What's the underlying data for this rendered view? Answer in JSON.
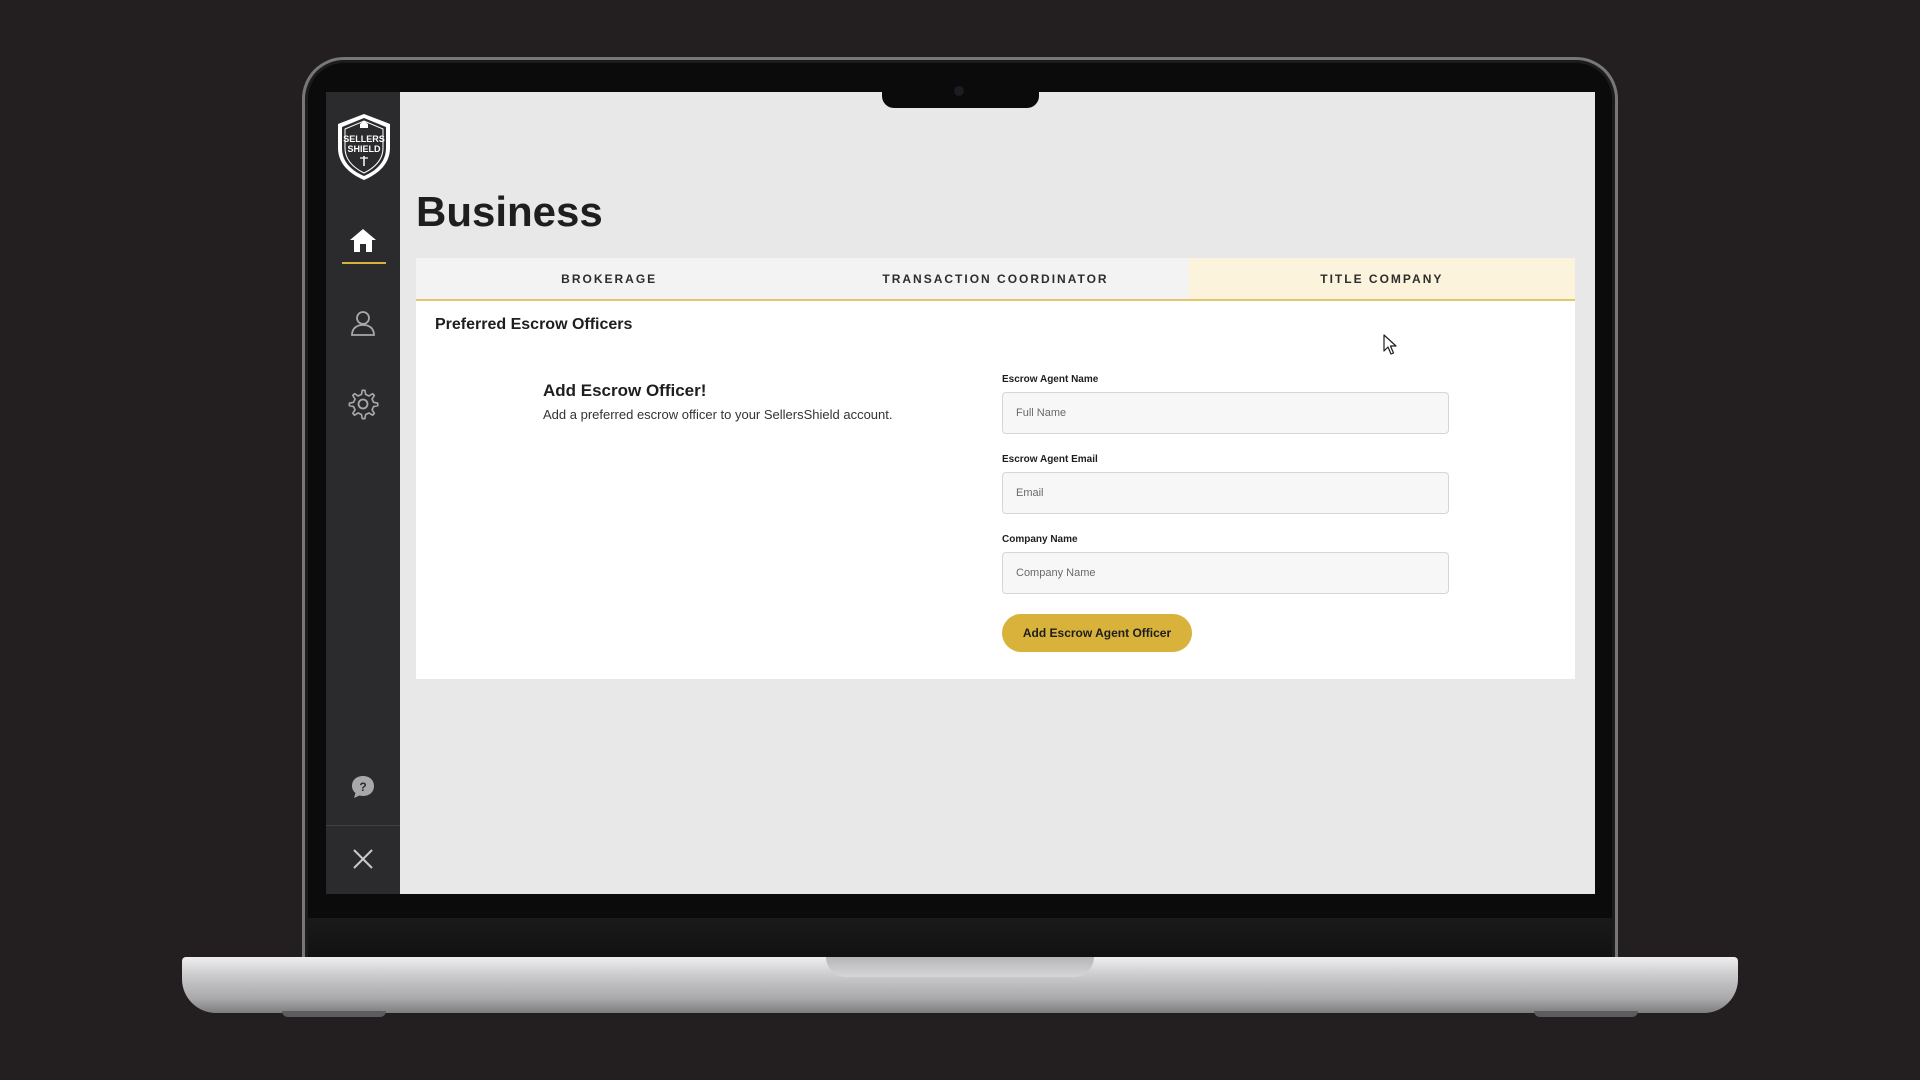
{
  "app": {
    "page_title": "Business",
    "logo_text": "SELLERS SHIELD"
  },
  "sidebar": {
    "items": [
      {
        "name": "home",
        "icon": "home-icon",
        "active": true
      },
      {
        "name": "profile",
        "icon": "user-icon",
        "active": false
      },
      {
        "name": "settings",
        "icon": "gear-icon",
        "active": false
      },
      {
        "name": "help",
        "icon": "help-chat-icon",
        "active": false
      },
      {
        "name": "close",
        "icon": "close-icon",
        "active": false
      }
    ]
  },
  "tabs": [
    {
      "label": "BROKERAGE",
      "active": false
    },
    {
      "label": "TRANSACTION COORDINATOR",
      "active": false
    },
    {
      "label": "TITLE COMPANY",
      "active": true
    }
  ],
  "section": {
    "title": "Preferred Escrow Officers",
    "intro_title": "Add Escrow Officer!",
    "intro_text": "Add a preferred escrow officer to your SellersShield account."
  },
  "form": {
    "name_label": "Escrow Agent Name",
    "name_placeholder": "Full Name",
    "email_label": "Escrow Agent Email",
    "email_placeholder": "Email",
    "company_label": "Company Name",
    "company_placeholder": "Company Name",
    "submit_label": "Add Escrow Agent Officer"
  },
  "colors": {
    "accent": "#d8b23a",
    "sidebar": "#2b2b2d",
    "background": "#e8e8e8"
  }
}
